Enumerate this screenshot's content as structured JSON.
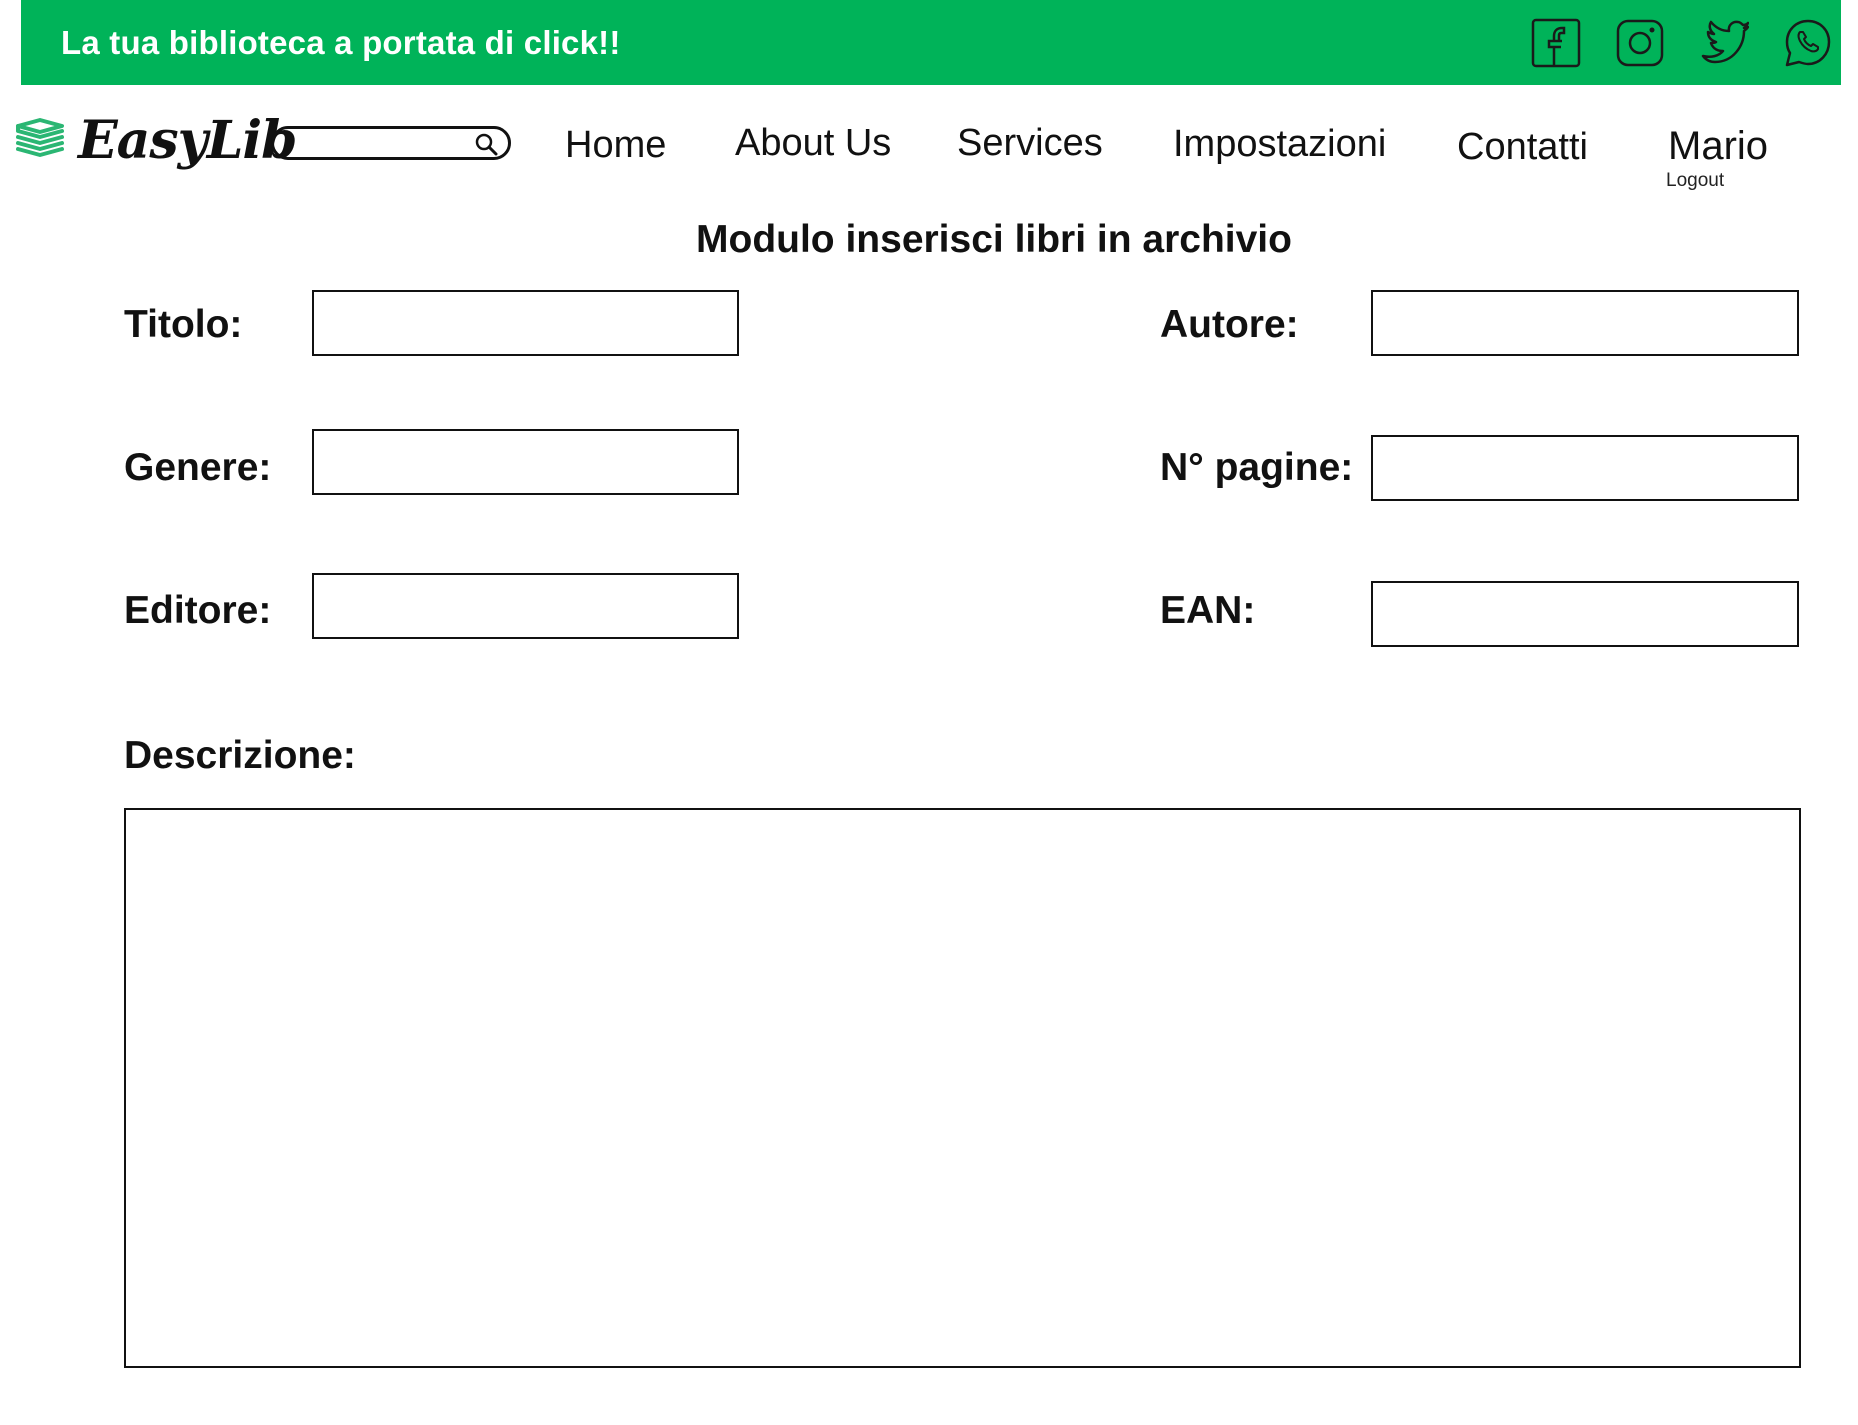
{
  "header": {
    "tagline": "La tua biblioteca a portata di click!!",
    "social_icons": [
      "facebook-icon",
      "instagram-icon",
      "twitter-icon",
      "whatsapp-icon"
    ],
    "colors": {
      "banner": "#00b359",
      "logo_icon": "#2bb673"
    }
  },
  "brand": {
    "name": "EasyLib"
  },
  "search": {
    "placeholder": ""
  },
  "nav": {
    "home": "Home",
    "about": "About Us",
    "services": "Services",
    "settings": "Impostazioni",
    "contacts": "Contatti"
  },
  "user": {
    "name": "Mario",
    "logout": "Logout"
  },
  "form": {
    "title": "Modulo inserisci libri in archivio",
    "titolo_label": "Titolo:",
    "autore_label": "Autore:",
    "genere_label": "Genere:",
    "pagine_label": "N° pagine:",
    "editore_label": "Editore:",
    "ean_label": "EAN:",
    "descrizione_label": "Descrizione:",
    "titolo_value": "",
    "autore_value": "",
    "genere_value": "",
    "pagine_value": "",
    "editore_value": "",
    "ean_value": "",
    "descrizione_value": ""
  }
}
